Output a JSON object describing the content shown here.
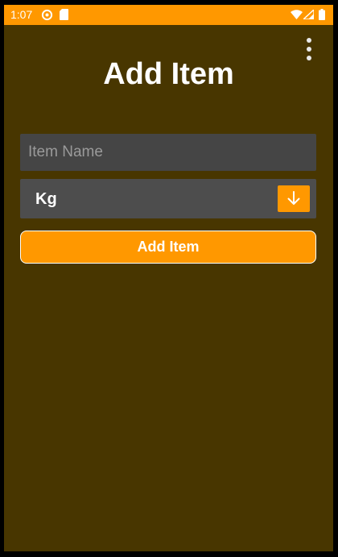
{
  "status_bar": {
    "time": "1:07",
    "left_icons": [
      "sync-icon",
      "sd-card-icon"
    ],
    "right_icons": [
      "wifi-icon",
      "signal-icon",
      "battery-icon"
    ],
    "color": "#FF9800"
  },
  "app_bar": {
    "menu_icon": "more-vert-icon"
  },
  "page": {
    "title": "Add Item",
    "background": "#483600"
  },
  "form": {
    "item_name": {
      "value": "",
      "placeholder": "Item Name"
    },
    "unit_select": {
      "selected": "Kg",
      "arrow_icon": "arrow-down-icon"
    },
    "submit_label": "Add Item"
  },
  "colors": {
    "accent": "#FF9800",
    "field_background": "#454545",
    "select_background": "#4d4d4d",
    "text": "#ffffff"
  }
}
